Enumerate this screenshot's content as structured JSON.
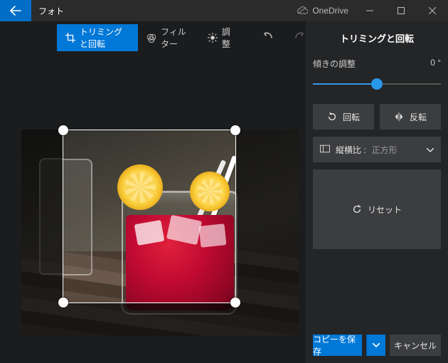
{
  "titlebar": {
    "app_title": "フォト",
    "onedrive_label": "OneDrive"
  },
  "toolbar": {
    "crop_rotate_label": "トリミングと回転",
    "filter_label": "フィルター",
    "adjust_label": "調整"
  },
  "panel": {
    "title": "トリミングと回転",
    "tilt_label": "傾きの調整",
    "tilt_value": "0 °",
    "rotate_label": "回転",
    "flip_label": "反転",
    "aspect_label": "縦横比 :",
    "aspect_value": "正方形",
    "reset_label": "リセット"
  },
  "footer": {
    "save_label": "コピーを保存",
    "cancel_label": "キャンセル"
  }
}
